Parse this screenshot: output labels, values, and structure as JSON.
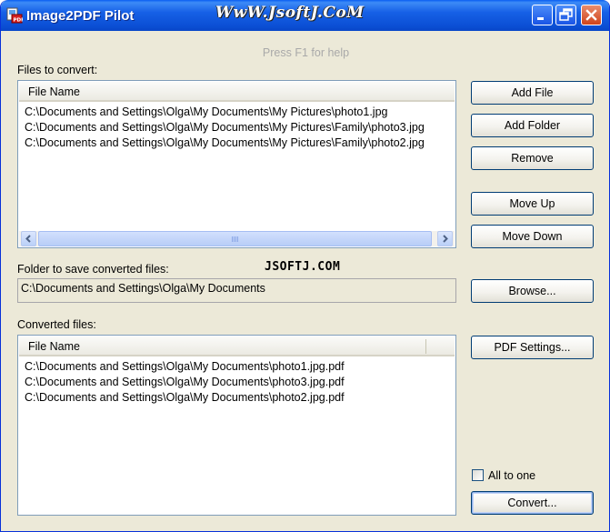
{
  "window": {
    "title": "Image2PDF Pilot",
    "watermark": "WwW.JsoftJ.CoM"
  },
  "help_text": "Press F1 for help",
  "files_to_convert": {
    "label": "Files to convert:",
    "column": "File Name",
    "rows": [
      "C:\\Documents and Settings\\Olga\\My Documents\\My Pictures\\photo1.jpg",
      "C:\\Documents and Settings\\Olga\\My Documents\\My Pictures\\Family\\photo3.jpg",
      "C:\\Documents and Settings\\Olga\\My Documents\\My Pictures\\Family\\photo2.jpg"
    ]
  },
  "buttons": {
    "add_file": "Add File",
    "add_folder": "Add Folder",
    "remove": "Remove",
    "move_up": "Move Up",
    "move_down": "Move Down",
    "browse": "Browse...",
    "pdf_settings": "PDF Settings...",
    "convert": "Convert..."
  },
  "save_folder": {
    "label": "Folder to save converted files:",
    "value": "C:\\Documents and Settings\\Olga\\My Documents"
  },
  "jsoftj_text": "JSOFTJ.COM",
  "converted_files": {
    "label": "Converted files:",
    "column": "File Name",
    "rows": [
      "C:\\Documents and Settings\\Olga\\My Documents\\photo1.jpg.pdf",
      "C:\\Documents and Settings\\Olga\\My Documents\\photo3.jpg.pdf",
      "C:\\Documents and Settings\\Olga\\My Documents\\photo2.jpg.pdf"
    ]
  },
  "all_to_one": {
    "label": "All to one",
    "checked": false
  }
}
